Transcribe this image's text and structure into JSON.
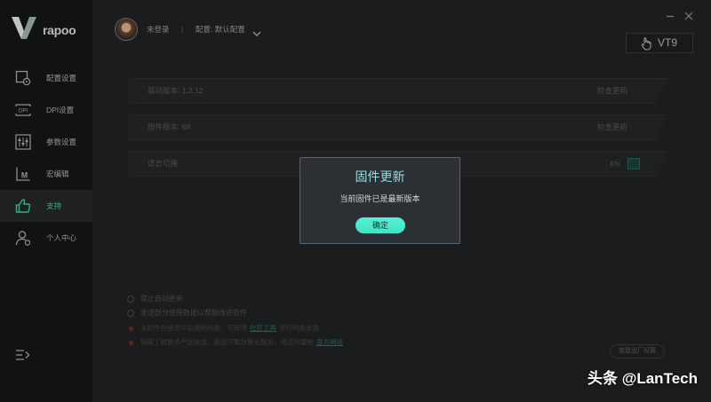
{
  "brand": {
    "logo_text": "rapoo"
  },
  "sidebar": {
    "items": [
      {
        "label": "配置设置",
        "icon": "profile-settings-icon",
        "active": false
      },
      {
        "label": "DPI设置",
        "icon": "dpi-icon",
        "icon_text": "DPI",
        "active": false
      },
      {
        "label": "参数设置",
        "icon": "sliders-icon",
        "active": false
      },
      {
        "label": "宏编辑",
        "icon": "macro-icon",
        "icon_text": "M",
        "active": false
      },
      {
        "label": "支持",
        "icon": "thumbs-up-icon",
        "active": true
      },
      {
        "label": "个人中心",
        "icon": "user-icon",
        "active": false
      }
    ],
    "collapse_icon": "collapse-menu-icon"
  },
  "header": {
    "user_status": "未登录",
    "separator": "|",
    "profile_label": "配置: 默认配置",
    "device_name": "VT9",
    "device_icon": "mouse-icon",
    "minimize_icon": "minimize-icon",
    "close_icon": "close-icon"
  },
  "support": {
    "rows": [
      {
        "label": "驱动版本: 1.2.12",
        "action": "检查更新"
      },
      {
        "label": "固件版本: 68",
        "action": "检查更新"
      },
      {
        "label": "语言切换",
        "toggle_value": "EN"
      }
    ],
    "options": [
      "禁止自动更新",
      "发送部分使用数据以帮助改进软件"
    ],
    "notes": [
      {
        "text": "本软件在使用中如遇到问题，可使用",
        "link": "社区工具",
        "text_after": "进行问题反馈"
      },
      {
        "text": "如需了解更多产品信息、驱动下载及售后服务，请访问雷柏",
        "link": "官方网站"
      }
    ],
    "reset_label": "恢复出厂设置"
  },
  "dialog": {
    "title": "固件更新",
    "message": "当前固件已是最新版本",
    "confirm_label": "确定"
  },
  "watermark": {
    "text": "头条 @LanTech"
  },
  "colors": {
    "accent": "#43e2c5",
    "active_menu": "#35c38f",
    "dialog_title": "#8ee0e2",
    "note_dot": "#7e2020",
    "link": "#1f6b5c"
  }
}
